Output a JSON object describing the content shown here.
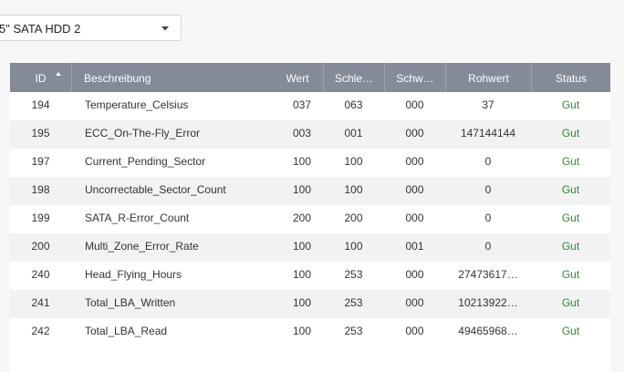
{
  "disk_selector": {
    "selected": "5\" SATA HDD 2"
  },
  "colors": {
    "header_bg": "#838b99",
    "status_good": "#2e8b2e",
    "row_alt": "#f2f2f3"
  },
  "table": {
    "columns": [
      "ID",
      "Beschreibung",
      "Wert",
      "Schle…",
      "Schw…",
      "Rohwert",
      "Status"
    ],
    "sort": {
      "column": "ID",
      "direction": "ascending"
    },
    "rows": [
      {
        "id": "194",
        "desc": "Temperature_Celsius",
        "value": "037",
        "worst": "063",
        "threshold": "000",
        "raw": "37",
        "status": "Gut"
      },
      {
        "id": "195",
        "desc": "ECC_On-The-Fly_Error",
        "value": "003",
        "worst": "001",
        "threshold": "000",
        "raw": "147144144",
        "status": "Gut"
      },
      {
        "id": "197",
        "desc": "Current_Pending_Sector",
        "value": "100",
        "worst": "100",
        "threshold": "000",
        "raw": "0",
        "status": "Gut"
      },
      {
        "id": "198",
        "desc": "Uncorrectable_Sector_Count",
        "value": "100",
        "worst": "100",
        "threshold": "000",
        "raw": "0",
        "status": "Gut"
      },
      {
        "id": "199",
        "desc": "SATA_R-Error_Count",
        "value": "200",
        "worst": "200",
        "threshold": "000",
        "raw": "0",
        "status": "Gut"
      },
      {
        "id": "200",
        "desc": "Multi_Zone_Error_Rate",
        "value": "100",
        "worst": "100",
        "threshold": "001",
        "raw": "0",
        "status": "Gut"
      },
      {
        "id": "240",
        "desc": "Head_Flying_Hours",
        "value": "100",
        "worst": "253",
        "threshold": "000",
        "raw": "27473617…",
        "status": "Gut"
      },
      {
        "id": "241",
        "desc": "Total_LBA_Written",
        "value": "100",
        "worst": "253",
        "threshold": "000",
        "raw": "10213922…",
        "status": "Gut"
      },
      {
        "id": "242",
        "desc": "Total_LBA_Read",
        "value": "100",
        "worst": "253",
        "threshold": "000",
        "raw": "49465968…",
        "status": "Gut"
      }
    ]
  }
}
